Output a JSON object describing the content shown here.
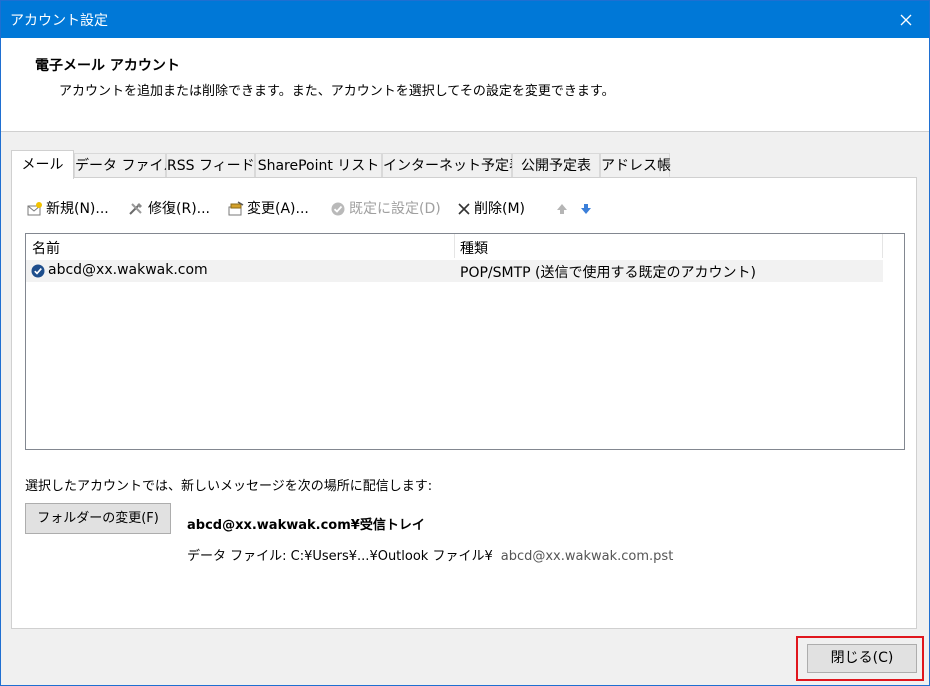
{
  "window": {
    "title": "アカウント設定"
  },
  "header": {
    "title": "電子メール アカウント",
    "description": "アカウントを追加または削除できます。また、アカウントを選択してその設定を変更できます。"
  },
  "tabs": [
    {
      "label": "メール",
      "active": true
    },
    {
      "label": "データ ファイル"
    },
    {
      "label": "RSS フィード"
    },
    {
      "label": "SharePoint リスト"
    },
    {
      "label": "インターネット予定表"
    },
    {
      "label": "公開予定表"
    },
    {
      "label": "アドレス帳"
    }
  ],
  "toolbar": {
    "new": "新規(N)...",
    "repair": "修復(R)...",
    "change": "変更(A)...",
    "set_default": "既定に設定(D)",
    "delete": "削除(M)"
  },
  "list": {
    "columns": [
      "名前",
      "種類"
    ],
    "rows": [
      {
        "name": "abcd@xx.wakwak.com",
        "type": "POP/SMTP (送信で使用する既定のアカウント)"
      }
    ]
  },
  "delivery": {
    "label": "選択したアカウントでは、新しいメッセージを次の場所に配信します:",
    "change_folder_button": "フォルダーの変更(F)",
    "target": "abcd@xx.wakwak.com¥受信トレイ",
    "data_file_label": "データ ファイル: C:¥Users¥...¥Outlook ファイル¥",
    "data_file_name": "abcd@xx.wakwak.com.pst"
  },
  "footer": {
    "close_button": "閉じる(C)"
  },
  "colors": {
    "titlebar": "#0078d7",
    "highlight": "#e0161d",
    "check": "#1e4e8c"
  }
}
